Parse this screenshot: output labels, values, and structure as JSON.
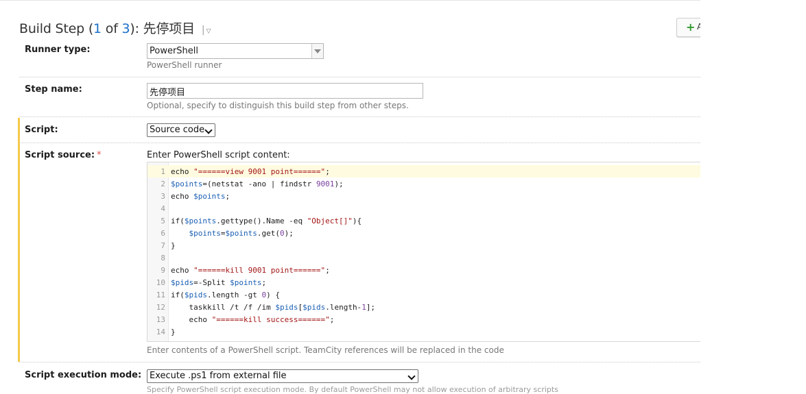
{
  "header": {
    "title_prefix": "Build Step (",
    "title_current": "1",
    "title_of": " of ",
    "title_total": "3",
    "title_suffix": "): 先停项目",
    "separator": "|",
    "caret": "▽",
    "add_button_plus": "+",
    "add_button_label": "A"
  },
  "runner": {
    "label": "Runner type:",
    "value": "PowerShell",
    "hint": "PowerShell runner"
  },
  "step_name": {
    "label": "Step name:",
    "value": "先停项目",
    "hint": "Optional, specify to distinguish this build step from other steps."
  },
  "script": {
    "label": "Script:",
    "value": "Source code"
  },
  "script_source": {
    "label": "Script source:",
    "required": "*",
    "intro": "Enter PowerShell script content:",
    "hint": "Enter contents of a PowerShell script. TeamCity references will be replaced in the code",
    "line_numbers": [
      "1",
      "2",
      "3",
      "4",
      "5",
      "6",
      "7",
      "8",
      "9",
      "10",
      "11",
      "12",
      "13",
      "14"
    ],
    "lines": [
      "echo \"======view 9001 point======\";",
      "$points=(netstat -ano | findstr 9001);",
      "echo $points;",
      "",
      "if($points.gettype().Name -eq \"Object[]\"){",
      "    $points=$points.get(0);",
      "}",
      "",
      "echo \"======kill 9001 point======\";",
      "$pids=-Split $points;",
      "if($pids.length -gt 0) {",
      "    taskkill /t /f /im $pids[$pids.length-1];",
      "    echo \"======kill success======\";",
      "}"
    ]
  },
  "exec_mode": {
    "label": "Script execution mode:",
    "value": "Execute .ps1 from external file",
    "hint_cutoff": "Specify PowerShell script execution mode. By default PowerShell may not allow execution of arbitrary scripts"
  },
  "colors": {
    "accent": "#1a6fc7",
    "highlight_bar": "#f5c94a",
    "required": "#d9534f",
    "add_plus": "#2e9a2e"
  }
}
